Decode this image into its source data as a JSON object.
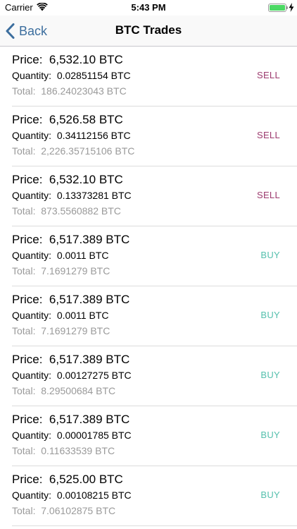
{
  "status_bar": {
    "carrier": "Carrier",
    "time": "5:43 PM",
    "battery_level": 1.0,
    "charging": true
  },
  "nav": {
    "back_label": "Back",
    "title": "BTC Trades"
  },
  "colors": {
    "sell": "#9c3a6e",
    "buy": "#55c0ad",
    "back": "#3c6e9e"
  },
  "trades": [
    {
      "price_label": "Price:",
      "price": "6,532.10 BTC",
      "qty_label": "Quantity:",
      "quantity": "0.02851154 BTC",
      "total_label": "Total:",
      "total": "186.24023043 BTC",
      "side": "SELL"
    },
    {
      "price_label": "Price:",
      "price": "6,526.58 BTC",
      "qty_label": "Quantity:",
      "quantity": "0.34112156 BTC",
      "total_label": "Total:",
      "total": "2,226.35715106 BTC",
      "side": "SELL"
    },
    {
      "price_label": "Price:",
      "price": "6,532.10 BTC",
      "qty_label": "Quantity:",
      "quantity": "0.13373281 BTC",
      "total_label": "Total:",
      "total": "873.5560882 BTC",
      "side": "SELL"
    },
    {
      "price_label": "Price:",
      "price": "6,517.389 BTC",
      "qty_label": "Quantity:",
      "quantity": "0.0011 BTC",
      "total_label": "Total:",
      "total": "7.1691279 BTC",
      "side": "BUY"
    },
    {
      "price_label": "Price:",
      "price": "6,517.389 BTC",
      "qty_label": "Quantity:",
      "quantity": "0.0011 BTC",
      "total_label": "Total:",
      "total": "7.1691279 BTC",
      "side": "BUY"
    },
    {
      "price_label": "Price:",
      "price": "6,517.389 BTC",
      "qty_label": "Quantity:",
      "quantity": "0.00127275 BTC",
      "total_label": "Total:",
      "total": "8.29500684 BTC",
      "side": "BUY"
    },
    {
      "price_label": "Price:",
      "price": "6,517.389 BTC",
      "qty_label": "Quantity:",
      "quantity": "0.00001785 BTC",
      "total_label": "Total:",
      "total": "0.11633539 BTC",
      "side": "BUY"
    },
    {
      "price_label": "Price:",
      "price": "6,525.00 BTC",
      "qty_label": "Quantity:",
      "quantity": "0.00108215 BTC",
      "total_label": "Total:",
      "total": "7.06102875 BTC",
      "side": "BUY"
    }
  ]
}
